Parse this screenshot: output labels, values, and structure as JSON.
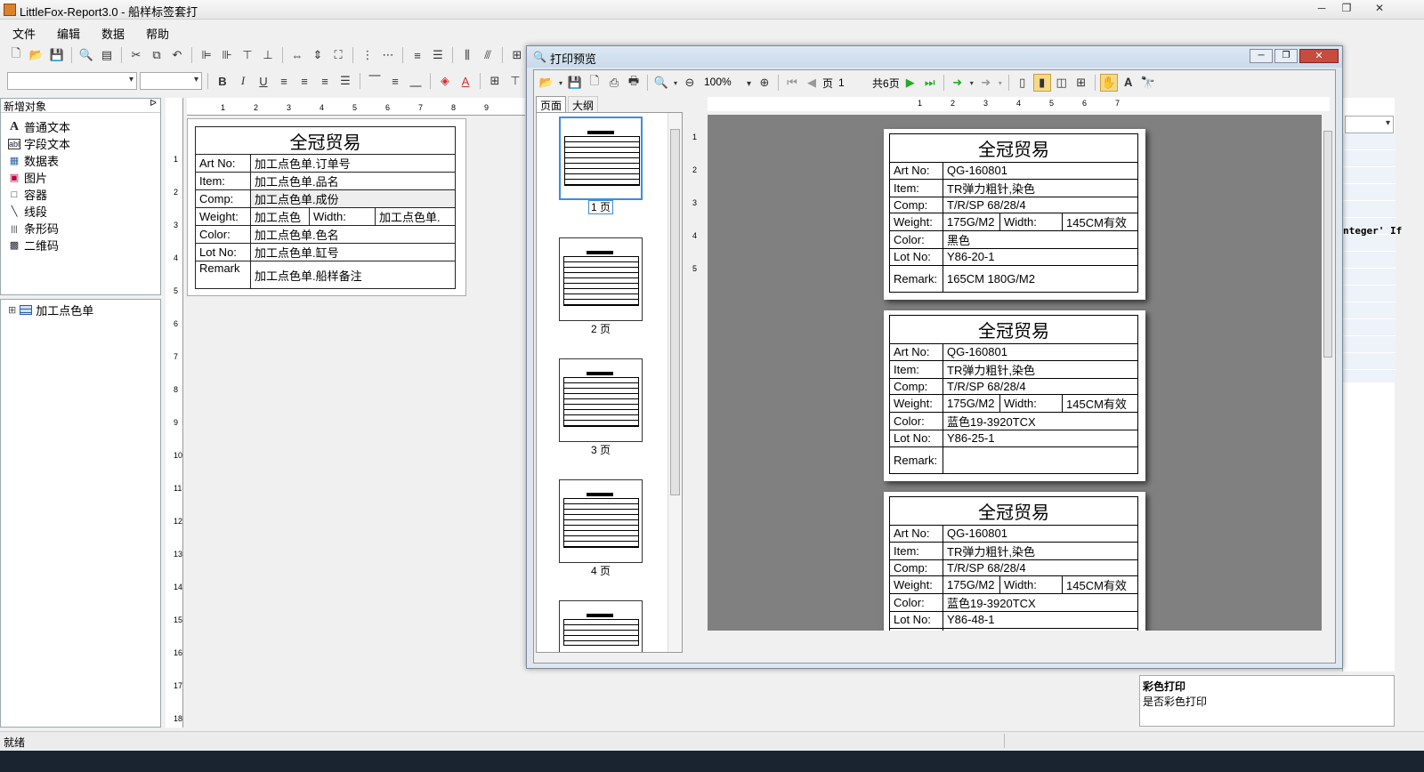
{
  "app": {
    "title": "LittleFox-Report3.0 - 船样标签套打",
    "menu": [
      "文件",
      "编辑",
      "数据",
      "帮助"
    ],
    "status": "就绪"
  },
  "left_panel": {
    "header": "新增对象",
    "pin": "ᐅ",
    "objects": [
      {
        "icon": "text-icon",
        "glyph": "A",
        "label": "普通文本"
      },
      {
        "icon": "field-text-icon",
        "glyph": "abl",
        "label": "字段文本"
      },
      {
        "icon": "table-icon",
        "glyph": "▦",
        "label": "数据表"
      },
      {
        "icon": "image-icon",
        "glyph": "▣",
        "label": "图片"
      },
      {
        "icon": "container-icon",
        "glyph": "□",
        "label": "容器"
      },
      {
        "icon": "line-icon",
        "glyph": "╲",
        "label": "线段"
      },
      {
        "icon": "barcode-icon",
        "glyph": "|||",
        "label": "条形码"
      },
      {
        "icon": "qrcode-icon",
        "glyph": "▩",
        "label": "二维码"
      }
    ],
    "tree": {
      "expand": "⊞",
      "label": "加工点色单"
    }
  },
  "designer": {
    "title": "全冠贸易",
    "rows": [
      {
        "label": "Art No:",
        "value": "加工点色单.订单号"
      },
      {
        "label": "Item:",
        "value": "加工点色单.品名"
      },
      {
        "label": "Comp:",
        "value": "加工点色单.成份"
      },
      {
        "label": "Weight:",
        "value": "加工点色",
        "label2": "Width:",
        "value2": "加工点色单."
      },
      {
        "label": "Color:",
        "value": "加工点色单.色名"
      },
      {
        "label": "Lot No:",
        "value": "加工点色单.缸号"
      },
      {
        "label": "Remark",
        "value": "加工点色单.船样备注"
      }
    ],
    "v_ruler": [
      "1",
      "2",
      "3",
      "4",
      "5",
      "6",
      "7",
      "8",
      "9",
      "10",
      "11",
      "12",
      "13",
      "14",
      "15",
      "16",
      "17",
      "18"
    ],
    "h_ruler": [
      "1",
      "2",
      "3",
      "4",
      "5",
      "6",
      "7",
      "8",
      "9"
    ]
  },
  "preview": {
    "title": "打印预览",
    "zoom": "100%",
    "page_label": "页",
    "page_value": "1",
    "total_pages": "共6页",
    "tabs": [
      "页面",
      "大纲"
    ],
    "thumbnails": [
      "1 页",
      "2 页",
      "3 页",
      "4 页"
    ],
    "h_ruler": [
      "1",
      "2",
      "3",
      "4",
      "5",
      "6",
      "7"
    ],
    "v_ruler": [
      "1",
      "2",
      "3",
      "4",
      "5"
    ],
    "pages": [
      {
        "title": "全冠贸易",
        "art_no": "QG-160801",
        "item": "TR弹力粗针,染色",
        "comp": "T/R/SP 68/28/4",
        "weight": "175G/M2",
        "width_label": "Width:",
        "width": "145CM有效",
        "color": "黑色",
        "lot_no": "Y86-20-1",
        "remark": "165CM 180G/M2"
      },
      {
        "title": "全冠贸易",
        "art_no": "QG-160801",
        "item": "TR弹力粗针,染色",
        "comp": "T/R/SP 68/28/4",
        "weight": "175G/M2",
        "width_label": "Width:",
        "width": "145CM有效",
        "color": "蓝色19-3920TCX",
        "lot_no": "Y86-25-1",
        "remark": ""
      },
      {
        "title": "全冠贸易",
        "art_no": "QG-160801",
        "item": "TR弹力粗针,染色",
        "comp": "T/R/SP 68/28/4",
        "weight": "175G/M2",
        "width_label": "Width:",
        "width": "145CM有效",
        "color": "蓝色19-3920TCX",
        "lot_no": "Y86-48-1",
        "remark": ""
      }
    ],
    "labels": {
      "art_no": "Art No:",
      "item": "Item:",
      "comp": "Comp:",
      "weight": "Weight:",
      "color": "Color:",
      "lot_no": "Lot No:",
      "remark": "Remark:"
    }
  },
  "right_panel": {
    "code_fragment": "nteger' If",
    "prop_title": "彩色打印",
    "prop_desc": "是否彩色打印"
  }
}
